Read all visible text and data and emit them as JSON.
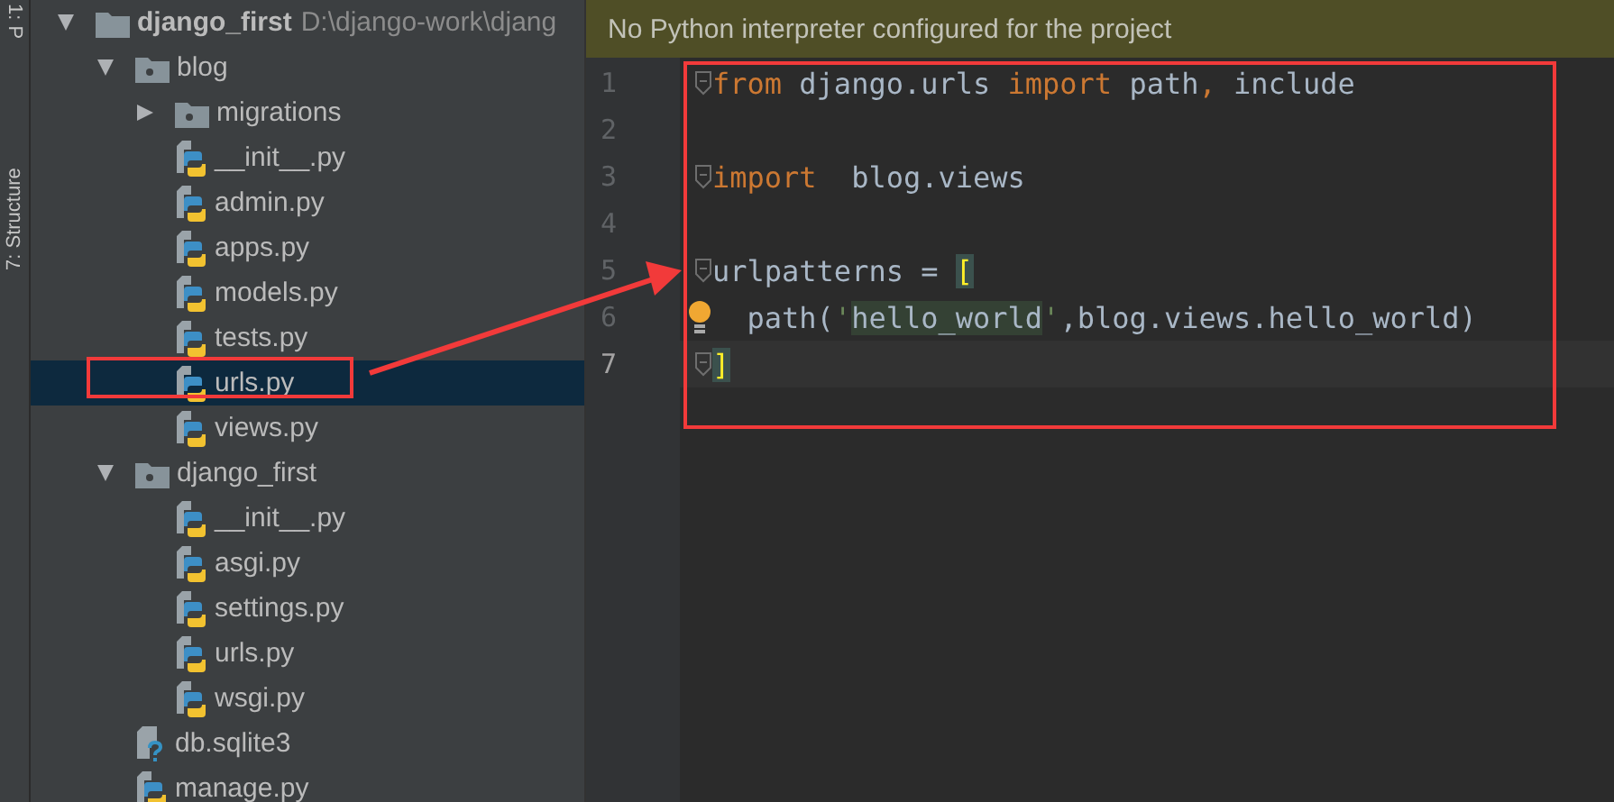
{
  "side_strip": {
    "tabs": [
      "1: P",
      "7: Structure"
    ]
  },
  "project_tree": {
    "root": {
      "name": "django_first",
      "path": "D:\\django-work\\djang",
      "expanded": true,
      "selected": false,
      "children": [
        {
          "name": "blog",
          "kind": "package",
          "expanded": true,
          "selected": false,
          "children": [
            {
              "name": "migrations",
              "kind": "package",
              "expanded": false,
              "selected": false
            },
            {
              "name": "__init__.py",
              "kind": "python",
              "selected": false
            },
            {
              "name": "admin.py",
              "kind": "python",
              "selected": false
            },
            {
              "name": "apps.py",
              "kind": "python",
              "selected": false
            },
            {
              "name": "models.py",
              "kind": "python",
              "selected": false
            },
            {
              "name": "tests.py",
              "kind": "python",
              "selected": false
            },
            {
              "name": "urls.py",
              "kind": "python",
              "selected": true
            },
            {
              "name": "views.py",
              "kind": "python",
              "selected": false
            }
          ]
        },
        {
          "name": "django_first",
          "kind": "package",
          "expanded": true,
          "selected": false,
          "children": [
            {
              "name": "__init__.py",
              "kind": "python",
              "selected": false
            },
            {
              "name": "asgi.py",
              "kind": "python",
              "selected": false
            },
            {
              "name": "settings.py",
              "kind": "python",
              "selected": false
            },
            {
              "name": "urls.py",
              "kind": "python",
              "selected": false
            },
            {
              "name": "wsgi.py",
              "kind": "python",
              "selected": false
            }
          ]
        },
        {
          "name": "db.sqlite3",
          "kind": "unknown",
          "selected": false
        },
        {
          "name": "manage.py",
          "kind": "python",
          "selected": false
        }
      ]
    }
  },
  "editor": {
    "banner": "No Python interpreter configured for the project",
    "lines": [
      {
        "number": "1",
        "fold": true,
        "bulb": false,
        "current": false,
        "tokens": [
          {
            "kind": "keyword",
            "text": "from"
          },
          {
            "kind": "plain",
            "text": " django.urls "
          },
          {
            "kind": "keyword",
            "text": "import"
          },
          {
            "kind": "plain",
            "text": " path"
          },
          {
            "kind": "keyword",
            "text": ","
          },
          {
            "kind": "plain",
            "text": " include"
          }
        ]
      },
      {
        "number": "2",
        "fold": false,
        "bulb": false,
        "current": false
      },
      {
        "number": "3",
        "fold": true,
        "bulb": false,
        "current": false,
        "tokens": [
          {
            "kind": "keyword",
            "text": "import"
          },
          {
            "kind": "plain",
            "text": "  blog.views"
          }
        ]
      },
      {
        "number": "4",
        "fold": false,
        "bulb": false,
        "current": false
      },
      {
        "number": "5",
        "fold": true,
        "bulb": false,
        "current": false,
        "tokens": [
          {
            "kind": "plain",
            "text": "urlpatterns = "
          },
          {
            "kind": "bracket",
            "text": "["
          }
        ]
      },
      {
        "number": "6",
        "fold": false,
        "bulb": true,
        "current": false,
        "tokens": [
          {
            "kind": "plain",
            "text": "  path("
          },
          {
            "kind": "string",
            "text": "'"
          },
          {
            "kind": "string-match",
            "text": "hello_world"
          },
          {
            "kind": "string",
            "text": "'"
          },
          {
            "kind": "plain",
            "text": ",blog.views.hello_world)"
          }
        ]
      },
      {
        "number": "7",
        "fold": true,
        "bulb": false,
        "current": true,
        "tokens": [
          {
            "kind": "bracket",
            "text": "]"
          }
        ]
      }
    ]
  }
}
